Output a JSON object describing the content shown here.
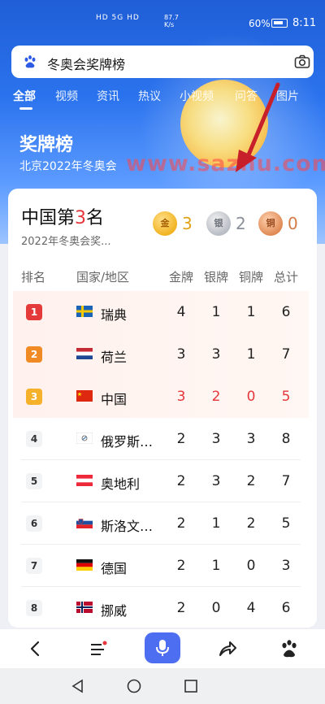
{
  "status_bar": {
    "network": "HD 5G HD",
    "speed": "87.7 K/s",
    "battery": "60%",
    "time": "8:11"
  },
  "search": {
    "query": "冬奥会奖牌榜"
  },
  "tabs": [
    "全部",
    "视频",
    "资讯",
    "热议",
    "小视频",
    "问答",
    "图片"
  ],
  "hero": {
    "title": "奖牌榜",
    "subtitle": "北京2022年冬奥会"
  },
  "watermark": "www.sazhu.com",
  "summary": {
    "title_prefix": "中国第",
    "rank_number": "3",
    "title_suffix": "名",
    "subtitle": "2022年冬奥会奖...",
    "gold_label": "金",
    "gold_count": "3",
    "silver_label": "银",
    "silver_count": "2",
    "bronze_label": "铜",
    "bronze_count": "0"
  },
  "table": {
    "headers": [
      "排名",
      "国家/地区",
      "金牌",
      "银牌",
      "铜牌",
      "总计"
    ],
    "rows": [
      {
        "rank": "1",
        "country": "瑞典",
        "gold": "4",
        "silver": "1",
        "bronze": "1",
        "total": "6",
        "flag": "sweden"
      },
      {
        "rank": "2",
        "country": "荷兰",
        "gold": "3",
        "silver": "3",
        "bronze": "1",
        "total": "7",
        "flag": "netherlands"
      },
      {
        "rank": "3",
        "country": "中国",
        "gold": "3",
        "silver": "2",
        "bronze": "0",
        "total": "5",
        "flag": "china"
      },
      {
        "rank": "4",
        "country": "俄罗斯…",
        "gold": "2",
        "silver": "3",
        "bronze": "3",
        "total": "8",
        "flag": "roc"
      },
      {
        "rank": "5",
        "country": "奥地利",
        "gold": "2",
        "silver": "3",
        "bronze": "2",
        "total": "7",
        "flag": "austria"
      },
      {
        "rank": "6",
        "country": "斯洛文…",
        "gold": "2",
        "silver": "1",
        "bronze": "2",
        "total": "5",
        "flag": "slovenia"
      },
      {
        "rank": "7",
        "country": "德国",
        "gold": "2",
        "silver": "1",
        "bronze": "0",
        "total": "3",
        "flag": "germany"
      },
      {
        "rank": "8",
        "country": "挪威",
        "gold": "2",
        "silver": "0",
        "bronze": "4",
        "total": "6",
        "flag": "norway"
      }
    ]
  },
  "bottom_nav": [
    "back-icon",
    "menu-icon",
    "mic-icon",
    "share-icon",
    "baidu-paw-icon"
  ],
  "system_nav": [
    "back-triangle-icon",
    "home-circle-icon",
    "recent-square-icon"
  ],
  "colors": {
    "accent": "#4e6ef2",
    "highlight_red": "#e5363b",
    "hero_blue": "#2b73ee"
  }
}
